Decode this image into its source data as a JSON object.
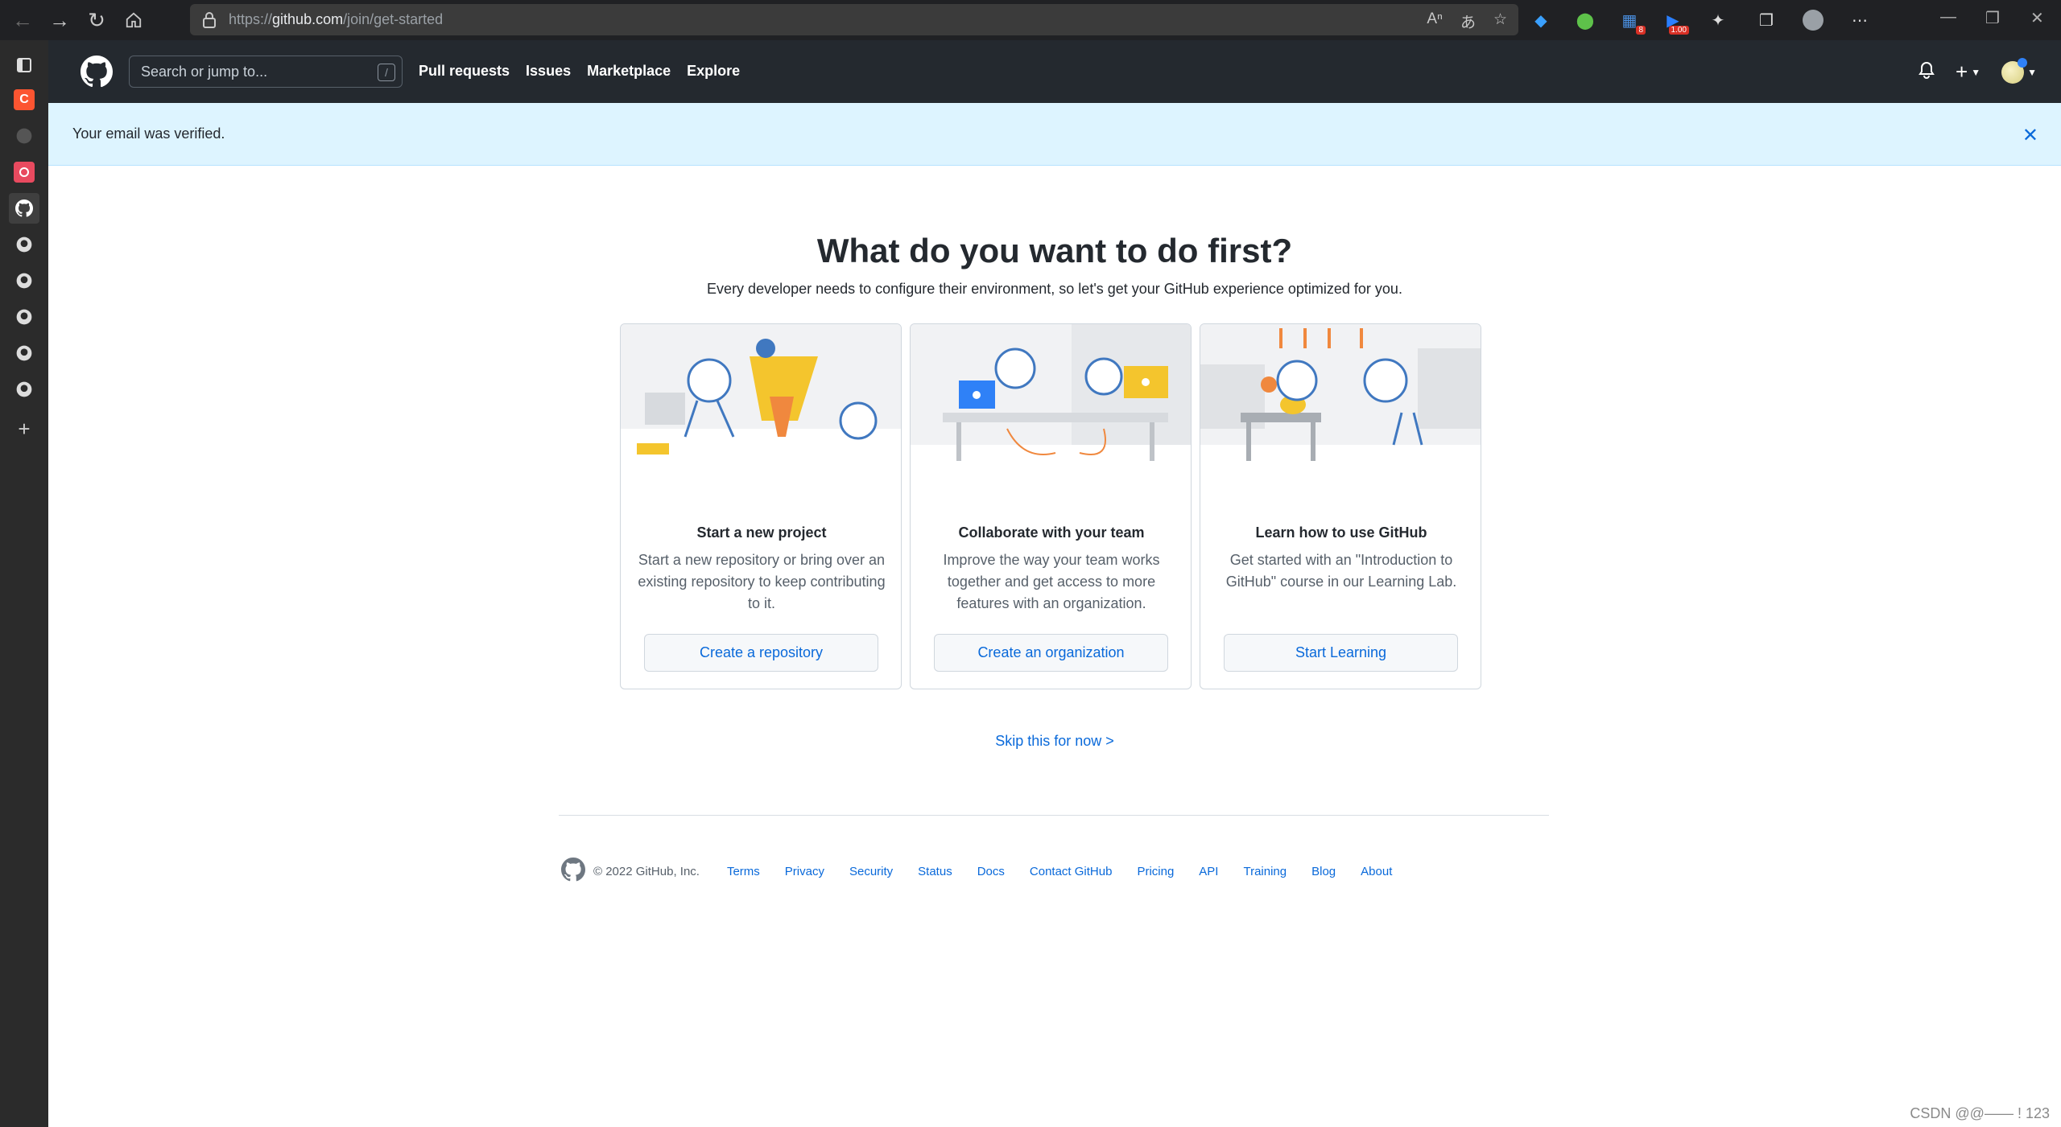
{
  "browser": {
    "url_prefix": "https://",
    "url_domain": "github.com",
    "url_path": "/join/get-started",
    "ext_badge_1": "8",
    "ext_badge_2": "1.00"
  },
  "header": {
    "search_placeholder": "Search or jump to...",
    "search_shortcut": "/",
    "nav": [
      "Pull requests",
      "Issues",
      "Marketplace",
      "Explore"
    ],
    "plus_label": "+"
  },
  "flash": {
    "message": "Your email was verified."
  },
  "main": {
    "title": "What do you want to do first?",
    "subtitle": "Every developer needs to configure their environment, so let's get your GitHub experience optimized for you.",
    "cards": [
      {
        "title": "Start a new project",
        "desc": "Start a new repository or bring over an existing repository to keep contributing to it.",
        "button": "Create a repository"
      },
      {
        "title": "Collaborate with your team",
        "desc": "Improve the way your team works together and get access to more features with an organization.",
        "button": "Create an organization"
      },
      {
        "title": "Learn how to use GitHub",
        "desc": "Get started with an \"Introduction to GitHub\" course in our Learning Lab.",
        "button": "Start Learning"
      }
    ],
    "skip": "Skip this for now >"
  },
  "footer": {
    "copyright": "© 2022 GitHub, Inc.",
    "links": [
      "Terms",
      "Privacy",
      "Security",
      "Status",
      "Docs",
      "Contact GitHub",
      "Pricing",
      "API",
      "Training",
      "Blog",
      "About"
    ]
  },
  "watermark": "CSDN @@—— ! 123",
  "colors": {
    "header_bg": "#24292f",
    "flash_bg": "#ddf4ff",
    "link": "#0969da",
    "accent_yellow": "#f4c52d",
    "accent_orange": "#f0883e"
  }
}
